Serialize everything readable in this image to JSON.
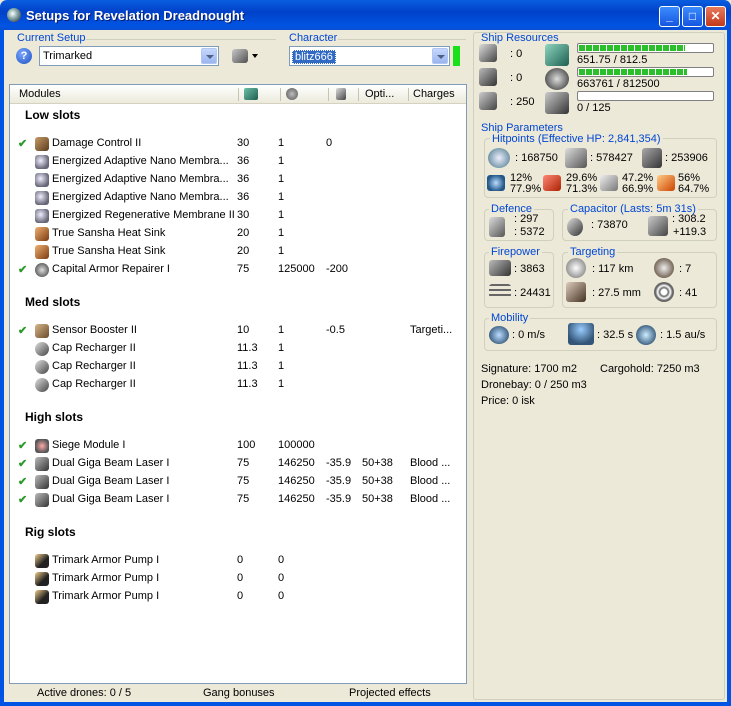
{
  "window": {
    "title": "Setups for Revelation Dreadnought"
  },
  "current_setup": {
    "label": "Current Setup",
    "value": "Trimarked"
  },
  "character": {
    "label": "Character",
    "value": "blitz666"
  },
  "columns": {
    "modules": "Modules",
    "opti": "Opti...",
    "charges": "Charges"
  },
  "sections": {
    "low": "Low slots",
    "med": "Med slots",
    "high": "High slots",
    "rig": "Rig slots"
  },
  "low_rows": [
    {
      "check": "✔",
      "name": "Damage Control II",
      "c1": "30",
      "c2": "1",
      "c3": "0",
      "c4": "",
      "c5": ""
    },
    {
      "check": "",
      "name": "Energized Adaptive Nano Membra...",
      "c1": "36",
      "c2": "1",
      "c3": "",
      "c4": "",
      "c5": ""
    },
    {
      "check": "",
      "name": "Energized Adaptive Nano Membra...",
      "c1": "36",
      "c2": "1",
      "c3": "",
      "c4": "",
      "c5": ""
    },
    {
      "check": "",
      "name": "Energized Adaptive Nano Membra...",
      "c1": "36",
      "c2": "1",
      "c3": "",
      "c4": "",
      "c5": ""
    },
    {
      "check": "",
      "name": "Energized Regenerative Membrane II",
      "c1": "30",
      "c2": "1",
      "c3": "",
      "c4": "",
      "c5": ""
    },
    {
      "check": "",
      "name": "True Sansha Heat Sink",
      "c1": "20",
      "c2": "1",
      "c3": "",
      "c4": "",
      "c5": ""
    },
    {
      "check": "",
      "name": "True Sansha Heat Sink",
      "c1": "20",
      "c2": "1",
      "c3": "",
      "c4": "",
      "c5": ""
    },
    {
      "check": "✔",
      "name": "Capital Armor Repairer I",
      "c1": "75",
      "c2": "125000",
      "c3": "-200",
      "c4": "",
      "c5": ""
    }
  ],
  "med_rows": [
    {
      "check": "✔",
      "name": "Sensor Booster II",
      "c1": "10",
      "c2": "1",
      "c3": "-0.5",
      "c4": "",
      "c5": "Targeti..."
    },
    {
      "check": "",
      "name": "Cap Recharger II",
      "c1": "11.3",
      "c2": "1",
      "c3": "",
      "c4": "",
      "c5": ""
    },
    {
      "check": "",
      "name": "Cap Recharger II",
      "c1": "11.3",
      "c2": "1",
      "c3": "",
      "c4": "",
      "c5": ""
    },
    {
      "check": "",
      "name": "Cap Recharger II",
      "c1": "11.3",
      "c2": "1",
      "c3": "",
      "c4": "",
      "c5": ""
    }
  ],
  "high_rows": [
    {
      "check": "✔",
      "name": "Siege Module I",
      "c1": "100",
      "c2": "100000",
      "c3": "",
      "c4": "",
      "c5": ""
    },
    {
      "check": "✔",
      "name": "Dual Giga Beam Laser I",
      "c1": "75",
      "c2": "146250",
      "c3": "-35.9",
      "c4": "50+38",
      "c5": "Blood ..."
    },
    {
      "check": "✔",
      "name": "Dual Giga Beam Laser I",
      "c1": "75",
      "c2": "146250",
      "c3": "-35.9",
      "c4": "50+38",
      "c5": "Blood ..."
    },
    {
      "check": "✔",
      "name": "Dual Giga Beam Laser I",
      "c1": "75",
      "c2": "146250",
      "c3": "-35.9",
      "c4": "50+38",
      "c5": "Blood ..."
    }
  ],
  "rig_rows": [
    {
      "check": "",
      "name": "Trimark Armor Pump I",
      "c1": "0",
      "c2": "0",
      "c3": "",
      "c4": "",
      "c5": ""
    },
    {
      "check": "",
      "name": "Trimark Armor Pump I",
      "c1": "0",
      "c2": "0",
      "c3": "",
      "c4": "",
      "c5": ""
    },
    {
      "check": "",
      "name": "Trimark Armor Pump I",
      "c1": "0",
      "c2": "0",
      "c3": "",
      "c4": "",
      "c5": ""
    }
  ],
  "status": {
    "drones": "Active drones: 0 / 5",
    "gang": "Gang bonuses",
    "projected": "Projected effects"
  },
  "resources": {
    "label": "Ship Resources",
    "hardpoints_turrets": ": 0",
    "hardpoints_launchers": ": 0",
    "calibration": ": 250",
    "cpu": "651.75 / 812.5",
    "cpu_fraction": 0.802,
    "power": "663761 / 812500",
    "power_fraction": 0.817,
    "drone_bandwidth": "0 / 125",
    "drone_fraction": 0
  },
  "params": {
    "label": "Ship Parameters",
    "hp_label": "Hitpoints (Effective HP: 2,841,354)",
    "shield_hp": ": 168750",
    "armor_hp": ": 578427",
    "hull_hp": ": 253906",
    "res_em": "12%\n77.9%",
    "res_therm": "29.6%\n71.3%",
    "res_kin": "47.2%\n66.9%",
    "res_exp": "56%\n64.7%",
    "res_em_top": "12%",
    "res_em_bot": "77.9%",
    "res_th_top": "29.6%",
    "res_th_bot": "71.3%",
    "res_ki_top": "47.2%",
    "res_ki_bot": "66.9%",
    "res_ex_top": "56%",
    "res_ex_bot": "64.7%",
    "defence_label": "Defence",
    "def_a": ": 297",
    "def_b": ": 5372",
    "cap_label": "Capacitor (Lasts: 5m 31s)",
    "cap_amount": ": 73870",
    "cap_a": ": 308.2",
    "cap_b": "+119.3",
    "firepower_label": "Firepower",
    "fp_a": ": 3863",
    "fp_b": ": 24431",
    "targeting_label": "Targeting",
    "tgt_range": ": 117 km",
    "tgt_count": ": 7",
    "tgt_res": ": 27.5 mm",
    "tgt_scan": ": 41",
    "mobility_label": "Mobility",
    "speed": ": 0 m/s",
    "align": ": 32.5 s",
    "warp": ": 1.5 au/s",
    "signature": "Signature: 1700 m2",
    "cargohold": "Cargohold: 7250 m3",
    "dronebay": "Dronebay: 0 / 250 m3",
    "price": "Price: 0 isk"
  }
}
